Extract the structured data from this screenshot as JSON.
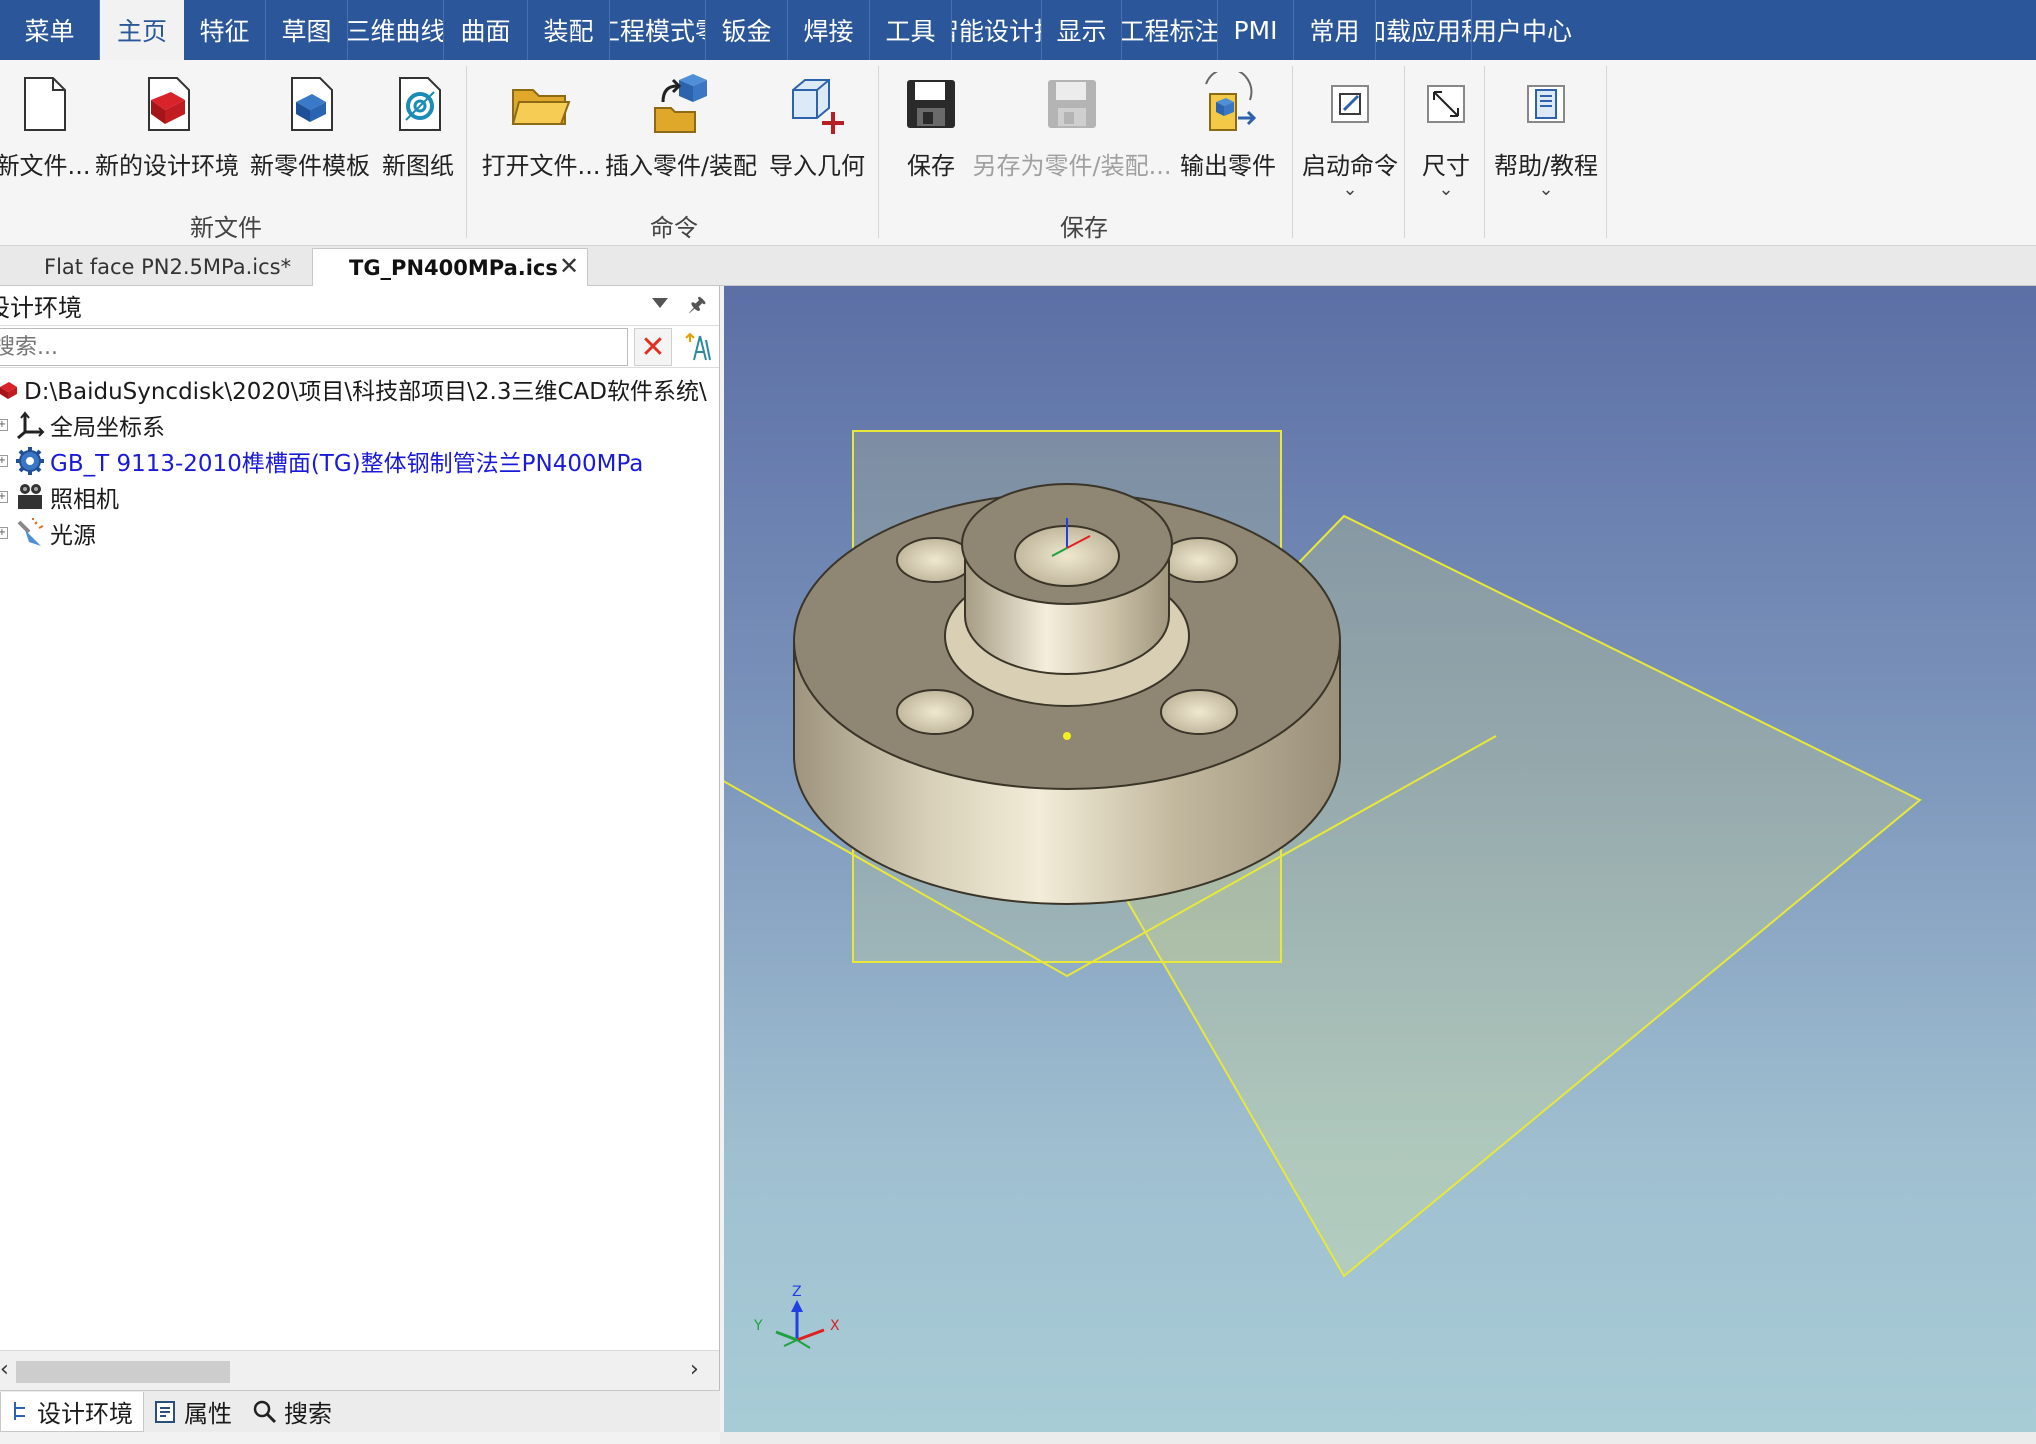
{
  "menu": {
    "tabs": [
      "菜单",
      "主页",
      "特征",
      "草图",
      "三维曲线",
      "曲面",
      "装配",
      "工程模式零",
      "钣金",
      "焊接",
      "工具",
      "智能设计批",
      "显示",
      "工程标注",
      "PMI",
      "常用",
      "加载应用程",
      "用户中心"
    ],
    "active": "主页"
  },
  "ribbon": {
    "new_file_group": {
      "label": "新文件",
      "new_file": "新文件...",
      "new_design_env": "新的设计环境",
      "new_part_template": "新零件模板",
      "new_drawing": "新图纸"
    },
    "command_group": {
      "label": "命令",
      "open_file": "打开文件...",
      "insert_part": "插入零件/装配",
      "import_geometry": "导入几何"
    },
    "save_group": {
      "label": "保存",
      "save": "保存",
      "save_as_part": "另存为零件/装配...",
      "export_part": "输出零件"
    },
    "start_command": "启动命令",
    "dimension": "尺寸",
    "help_tutorial": "帮助/教程"
  },
  "doc_tabs": {
    "tab1": "Flat face PN2.5MPa.ics*",
    "tab2": "TG_PN400MPa.ics"
  },
  "left_panel": {
    "title": "设计环境",
    "search_placeholder": "搜索...",
    "tree": {
      "root": "D:\\BaiduSyncdisk\\2020\\项目\\科技部项目\\2.3三维CAD软件系统\\",
      "global_coords": "全局坐标系",
      "part": "GB_T 9113-2010榫槽面(TG)整体钢制管法兰PN400MPa",
      "camera": "照相机",
      "light": "光源"
    }
  },
  "bottom_tabs": {
    "design_env": "设计环境",
    "properties": "属性",
    "search": "搜索"
  },
  "viewport": {
    "axis_x": "X",
    "axis_y": "Y",
    "axis_z": "Z"
  },
  "colors": {
    "menu_bar": "#2b579a",
    "plane_outline": "#e8e83a",
    "part_body": "#a89e88",
    "tree_link": "#1a1ad8"
  }
}
